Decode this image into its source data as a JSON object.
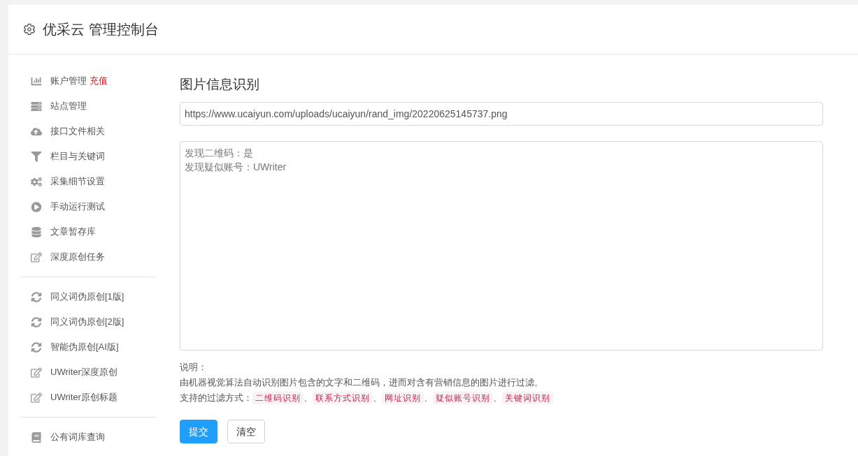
{
  "header": {
    "title": "优采云 管理控制台"
  },
  "sidebar": {
    "groups": [
      {
        "items": [
          {
            "kind": "chart",
            "label": "账户管理",
            "badge": "充值"
          },
          {
            "kind": "server",
            "label": "站点管理"
          },
          {
            "kind": "cloud",
            "label": "接口文件相关"
          },
          {
            "kind": "filter",
            "label": "栏目与关键词"
          },
          {
            "kind": "cogs",
            "label": "采集细节设置"
          },
          {
            "kind": "play",
            "label": "手动运行测试"
          },
          {
            "kind": "database",
            "label": "文章暂存库"
          },
          {
            "kind": "edit",
            "label": "深度原创任务"
          }
        ]
      },
      {
        "items": [
          {
            "kind": "sync",
            "label": "同义词伪原创[1版]"
          },
          {
            "kind": "sync",
            "label": "同义词伪原创[2版]"
          },
          {
            "kind": "sync",
            "label": "智能伪原创[AI版]"
          },
          {
            "kind": "edit",
            "label": "UWriter深度原创"
          },
          {
            "kind": "edit",
            "label": "UWriter原创标题"
          }
        ]
      },
      {
        "items": [
          {
            "kind": "book",
            "label": "公有词库查询"
          }
        ]
      }
    ]
  },
  "main": {
    "title": "图片信息识别",
    "url_field": {
      "value": "https://www.ucaiyun.com/uploads/ucaiyun/rand_img/20220625145737.png"
    },
    "result_box": {
      "lines": [
        "发现二维码：是",
        "发现疑似账号：UWriter"
      ]
    },
    "notes": {
      "heading": "说明：",
      "description": "由机器视觉算法自动识别图片包含的文字和二维码，进而对含有营销信息的图片进行过滤。",
      "filters_label": "支持的过滤方式：",
      "separator": "、",
      "filters": [
        "二维码识别",
        "联系方式识别",
        "网址识别",
        "疑似账号识别",
        "关键词识别"
      ]
    },
    "buttons": [
      {
        "kind": "primary",
        "label": "提交"
      },
      {
        "kind": "default",
        "label": "清空"
      }
    ]
  }
}
